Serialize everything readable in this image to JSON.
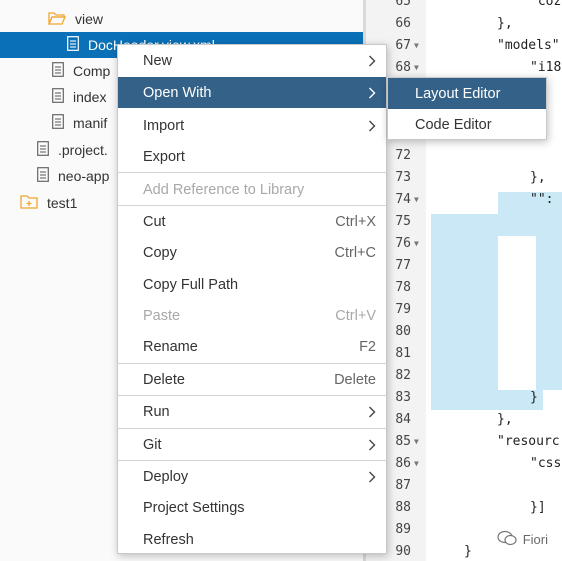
{
  "tree": {
    "items": [
      {
        "label": "view",
        "kind": "folder-open"
      },
      {
        "label": "DocHeader.view.xml",
        "kind": "file",
        "selected": true
      },
      {
        "label": "Comp",
        "kind": "file"
      },
      {
        "label": "index",
        "kind": "file"
      },
      {
        "label": "manif",
        "kind": "file"
      },
      {
        "label": ".project.",
        "kind": "file"
      },
      {
        "label": "neo-app",
        "kind": "file"
      },
      {
        "label": "test1",
        "kind": "project-folder"
      }
    ]
  },
  "editor": {
    "line_numbers": [
      "65",
      "66",
      "67",
      "68",
      "",
      "",
      "",
      "72",
      "73",
      "74",
      "75",
      "76",
      "77",
      "78",
      "79",
      "80",
      "81",
      "82",
      "83",
      "84",
      "85",
      "86",
      "87",
      "88",
      "89",
      "90"
    ],
    "code_lines": [
      {
        "ln": "65",
        "text": "\"coz"
      },
      {
        "ln": "66",
        "text": "},"
      },
      {
        "ln": "67",
        "text": "\"models\""
      },
      {
        "ln": "68",
        "text": "\"i18"
      },
      {
        "ln": "73",
        "text": "},"
      },
      {
        "ln": "74",
        "text": "\"\":"
      },
      {
        "ln": "83",
        "text": "}"
      },
      {
        "ln": "84",
        "text": "},"
      },
      {
        "ln": "85",
        "text": "\"resourc"
      },
      {
        "ln": "86",
        "text": "\"css"
      },
      {
        "ln": "88",
        "text": "}]"
      },
      {
        "ln": "90",
        "text": "}"
      }
    ],
    "watermark": "Fiori"
  },
  "context_menu": {
    "items": [
      {
        "label": "New",
        "submenu": true
      },
      {
        "label": "Open With",
        "submenu": true,
        "active": true
      },
      {
        "label": "Import",
        "submenu": true
      },
      {
        "label": "Export"
      },
      {
        "label": "Add Reference to Library",
        "disabled": true
      },
      {
        "label": "Cut",
        "shortcut": "Ctrl+X"
      },
      {
        "label": "Copy",
        "shortcut": "Ctrl+C"
      },
      {
        "label": "Copy Full Path"
      },
      {
        "label": "Paste",
        "shortcut": "Ctrl+V",
        "disabled": true
      },
      {
        "label": "Rename",
        "shortcut": "F2"
      },
      {
        "label": "Delete",
        "shortcut": "Delete"
      },
      {
        "label": "Run",
        "submenu": true
      },
      {
        "label": "Git",
        "submenu": true
      },
      {
        "label": "Deploy",
        "submenu": true
      },
      {
        "label": "Project Settings"
      },
      {
        "label": "Refresh"
      }
    ]
  },
  "submenu": {
    "items": [
      {
        "label": "Layout Editor",
        "active": true
      },
      {
        "label": "Code Editor"
      }
    ]
  },
  "colors": {
    "selection": "#0a71b8",
    "menu_active": "#346187",
    "code_highlight": "#cbe8f7",
    "folder_icon": "#f0a830"
  }
}
